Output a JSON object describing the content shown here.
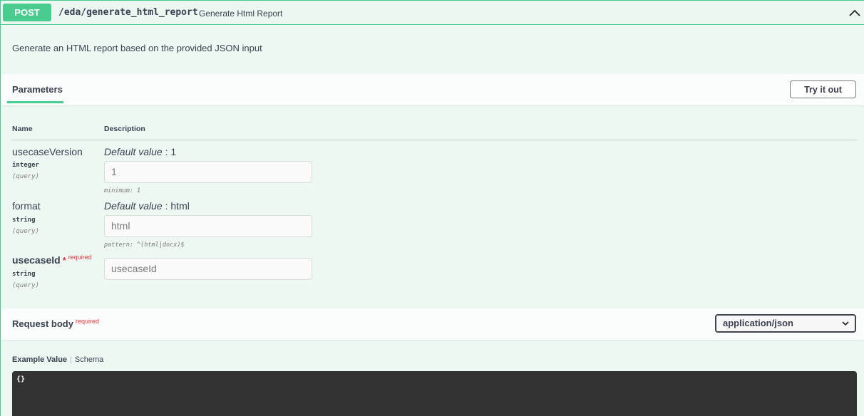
{
  "endpoint": {
    "method": "POST",
    "path": "/eda/generate_html_report",
    "summary": "Generate Html Report",
    "description": "Generate an HTML report based on the provided JSON input"
  },
  "parameters_section": {
    "tab_label": "Parameters",
    "try_it_out_label": "Try it out",
    "col_name": "Name",
    "col_description": "Description"
  },
  "parameters": [
    {
      "name": "usecaseVersion",
      "type": "integer",
      "in": "(query)",
      "default_label": "Default value",
      "default_sep": " : ",
      "default_value": "1",
      "input_value": "1",
      "constraint": "minimum: 1"
    },
    {
      "name": "format",
      "type": "string",
      "in": "(query)",
      "default_label": "Default value",
      "default_sep": " : ",
      "default_value": "html",
      "input_value": "html",
      "constraint": "pattern: ^(html|docx)$"
    },
    {
      "name": "usecaseId",
      "required_star": "*",
      "required_label": "required",
      "type": "string",
      "in": "(query)",
      "placeholder": "usecaseId"
    }
  ],
  "request_body": {
    "title": "Request body",
    "required_label": "required",
    "content_type": "application/json",
    "tab_example": "Example Value",
    "tab_schema": "Schema",
    "example": "{}"
  },
  "colors": {
    "method_post": "#49cc90",
    "block_bg": "#edf8f3",
    "required": "#e2393b",
    "code_bg": "#333333"
  }
}
